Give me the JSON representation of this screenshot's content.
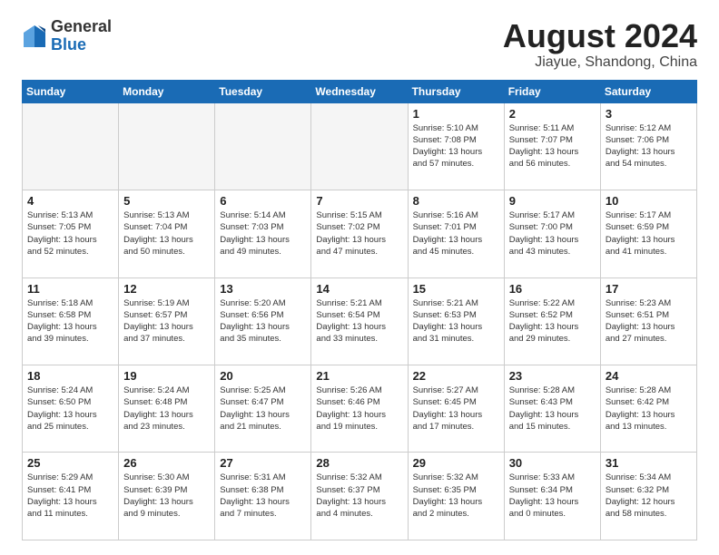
{
  "header": {
    "logo_general": "General",
    "logo_blue": "Blue",
    "title": "August 2024",
    "location": "Jiayue, Shandong, China"
  },
  "weekdays": [
    "Sunday",
    "Monday",
    "Tuesday",
    "Wednesday",
    "Thursday",
    "Friday",
    "Saturday"
  ],
  "weeks": [
    [
      {
        "day": "",
        "info": ""
      },
      {
        "day": "",
        "info": ""
      },
      {
        "day": "",
        "info": ""
      },
      {
        "day": "",
        "info": ""
      },
      {
        "day": "1",
        "info": "Sunrise: 5:10 AM\nSunset: 7:08 PM\nDaylight: 13 hours\nand 57 minutes."
      },
      {
        "day": "2",
        "info": "Sunrise: 5:11 AM\nSunset: 7:07 PM\nDaylight: 13 hours\nand 56 minutes."
      },
      {
        "day": "3",
        "info": "Sunrise: 5:12 AM\nSunset: 7:06 PM\nDaylight: 13 hours\nand 54 minutes."
      }
    ],
    [
      {
        "day": "4",
        "info": "Sunrise: 5:13 AM\nSunset: 7:05 PM\nDaylight: 13 hours\nand 52 minutes."
      },
      {
        "day": "5",
        "info": "Sunrise: 5:13 AM\nSunset: 7:04 PM\nDaylight: 13 hours\nand 50 minutes."
      },
      {
        "day": "6",
        "info": "Sunrise: 5:14 AM\nSunset: 7:03 PM\nDaylight: 13 hours\nand 49 minutes."
      },
      {
        "day": "7",
        "info": "Sunrise: 5:15 AM\nSunset: 7:02 PM\nDaylight: 13 hours\nand 47 minutes."
      },
      {
        "day": "8",
        "info": "Sunrise: 5:16 AM\nSunset: 7:01 PM\nDaylight: 13 hours\nand 45 minutes."
      },
      {
        "day": "9",
        "info": "Sunrise: 5:17 AM\nSunset: 7:00 PM\nDaylight: 13 hours\nand 43 minutes."
      },
      {
        "day": "10",
        "info": "Sunrise: 5:17 AM\nSunset: 6:59 PM\nDaylight: 13 hours\nand 41 minutes."
      }
    ],
    [
      {
        "day": "11",
        "info": "Sunrise: 5:18 AM\nSunset: 6:58 PM\nDaylight: 13 hours\nand 39 minutes."
      },
      {
        "day": "12",
        "info": "Sunrise: 5:19 AM\nSunset: 6:57 PM\nDaylight: 13 hours\nand 37 minutes."
      },
      {
        "day": "13",
        "info": "Sunrise: 5:20 AM\nSunset: 6:56 PM\nDaylight: 13 hours\nand 35 minutes."
      },
      {
        "day": "14",
        "info": "Sunrise: 5:21 AM\nSunset: 6:54 PM\nDaylight: 13 hours\nand 33 minutes."
      },
      {
        "day": "15",
        "info": "Sunrise: 5:21 AM\nSunset: 6:53 PM\nDaylight: 13 hours\nand 31 minutes."
      },
      {
        "day": "16",
        "info": "Sunrise: 5:22 AM\nSunset: 6:52 PM\nDaylight: 13 hours\nand 29 minutes."
      },
      {
        "day": "17",
        "info": "Sunrise: 5:23 AM\nSunset: 6:51 PM\nDaylight: 13 hours\nand 27 minutes."
      }
    ],
    [
      {
        "day": "18",
        "info": "Sunrise: 5:24 AM\nSunset: 6:50 PM\nDaylight: 13 hours\nand 25 minutes."
      },
      {
        "day": "19",
        "info": "Sunrise: 5:24 AM\nSunset: 6:48 PM\nDaylight: 13 hours\nand 23 minutes."
      },
      {
        "day": "20",
        "info": "Sunrise: 5:25 AM\nSunset: 6:47 PM\nDaylight: 13 hours\nand 21 minutes."
      },
      {
        "day": "21",
        "info": "Sunrise: 5:26 AM\nSunset: 6:46 PM\nDaylight: 13 hours\nand 19 minutes."
      },
      {
        "day": "22",
        "info": "Sunrise: 5:27 AM\nSunset: 6:45 PM\nDaylight: 13 hours\nand 17 minutes."
      },
      {
        "day": "23",
        "info": "Sunrise: 5:28 AM\nSunset: 6:43 PM\nDaylight: 13 hours\nand 15 minutes."
      },
      {
        "day": "24",
        "info": "Sunrise: 5:28 AM\nSunset: 6:42 PM\nDaylight: 13 hours\nand 13 minutes."
      }
    ],
    [
      {
        "day": "25",
        "info": "Sunrise: 5:29 AM\nSunset: 6:41 PM\nDaylight: 13 hours\nand 11 minutes."
      },
      {
        "day": "26",
        "info": "Sunrise: 5:30 AM\nSunset: 6:39 PM\nDaylight: 13 hours\nand 9 minutes."
      },
      {
        "day": "27",
        "info": "Sunrise: 5:31 AM\nSunset: 6:38 PM\nDaylight: 13 hours\nand 7 minutes."
      },
      {
        "day": "28",
        "info": "Sunrise: 5:32 AM\nSunset: 6:37 PM\nDaylight: 13 hours\nand 4 minutes."
      },
      {
        "day": "29",
        "info": "Sunrise: 5:32 AM\nSunset: 6:35 PM\nDaylight: 13 hours\nand 2 minutes."
      },
      {
        "day": "30",
        "info": "Sunrise: 5:33 AM\nSunset: 6:34 PM\nDaylight: 13 hours\nand 0 minutes."
      },
      {
        "day": "31",
        "info": "Sunrise: 5:34 AM\nSunset: 6:32 PM\nDaylight: 12 hours\nand 58 minutes."
      }
    ]
  ]
}
